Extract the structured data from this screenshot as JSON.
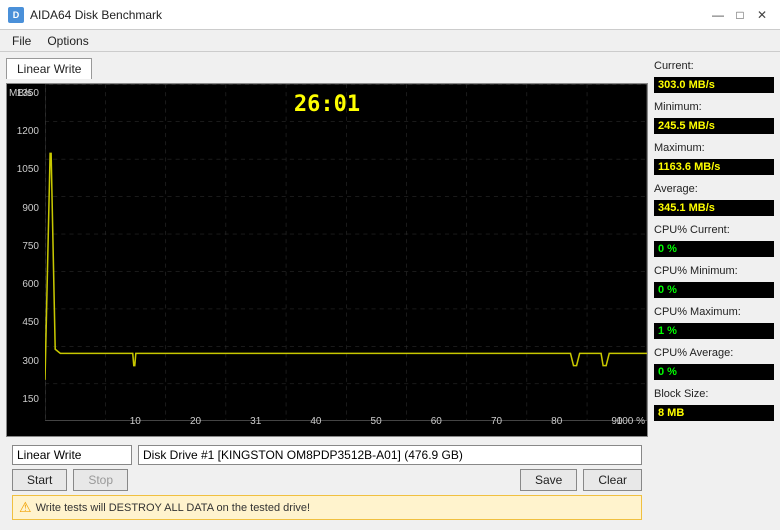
{
  "titleBar": {
    "icon": "D",
    "title": "AIDA64 Disk Benchmark",
    "minBtn": "—",
    "maxBtn": "□",
    "closeBtn": "✕"
  },
  "menuBar": {
    "items": [
      "File",
      "Options"
    ]
  },
  "tab": {
    "label": "Linear Write"
  },
  "chart": {
    "timer": "26:01",
    "yAxisTitle": "MB/s",
    "yLabels": [
      "1350",
      "1200",
      "1050",
      "900",
      "750",
      "600",
      "450",
      "300",
      "150",
      ""
    ],
    "xLabels": [
      "",
      "10",
      "20",
      "31",
      "40",
      "50",
      "60",
      "70",
      "80",
      "90"
    ],
    "xPercent": "100 %"
  },
  "stats": {
    "currentLabel": "Current:",
    "currentValue": "303.0 MB/s",
    "minimumLabel": "Minimum:",
    "minimumValue": "245.5 MB/s",
    "maximumLabel": "Maximum:",
    "maximumValue": "1163.6 MB/s",
    "averageLabel": "Average:",
    "averageValue": "345.1 MB/s",
    "cpuCurrentLabel": "CPU% Current:",
    "cpuCurrentValue": "0 %",
    "cpuMinimumLabel": "CPU% Minimum:",
    "cpuMinimumValue": "0 %",
    "cpuMaximumLabel": "CPU% Maximum:",
    "cpuMaximumValue": "1 %",
    "cpuAverageLabel": "CPU% Average:",
    "cpuAverageValue": "0 %",
    "blockSizeLabel": "Block Size:",
    "blockSizeValue": "8 MB"
  },
  "controls": {
    "testDropdown": "Linear Write",
    "driveDropdown": "Disk Drive #1 [KINGSTON OM8PDP3512B-A01] (476.9 GB)",
    "startBtn": "Start",
    "stopBtn": "Stop",
    "saveBtn": "Save",
    "clearBtn": "Clear",
    "warning": "Write tests will DESTROY ALL DATA on the tested drive!"
  }
}
